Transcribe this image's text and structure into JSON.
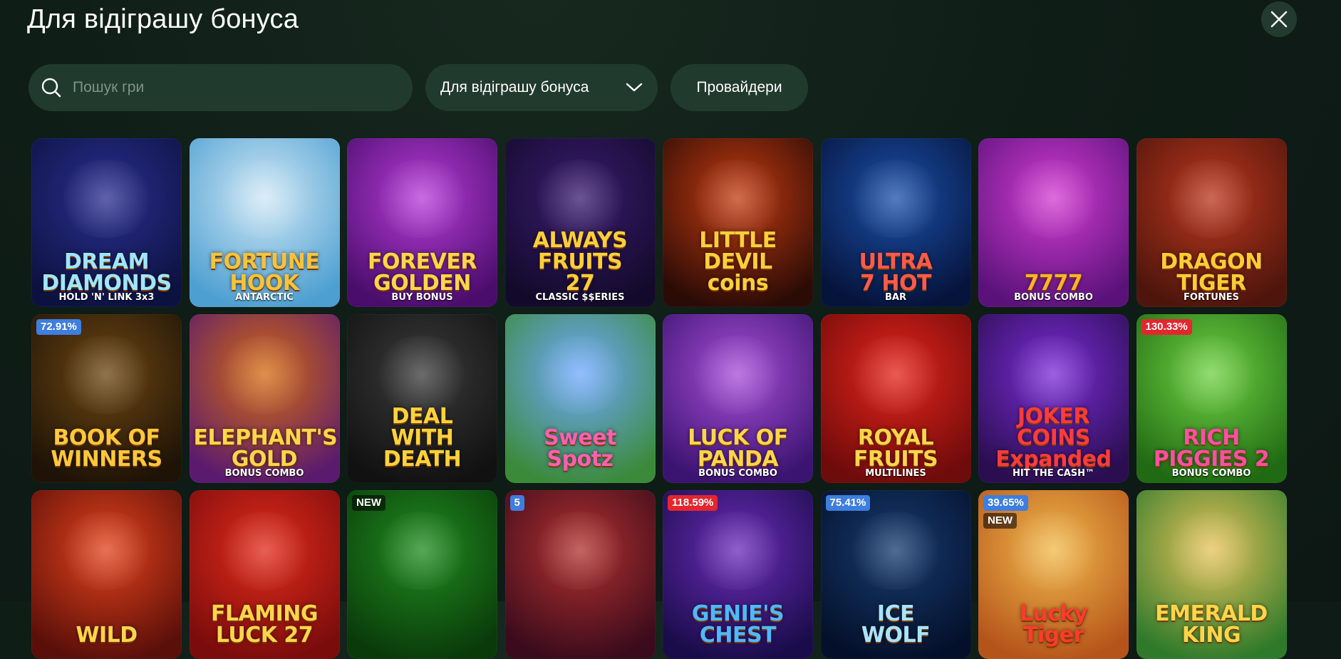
{
  "header": {
    "title": "Для відіграшу бонуса",
    "close_icon": "close-icon"
  },
  "search": {
    "placeholder": "Пошук гри",
    "value": "",
    "icon": "search-icon"
  },
  "filter": {
    "selected": "Для відіграшу бонуса",
    "icon": "chevron-down-icon"
  },
  "providers": {
    "label": "Провайдери"
  },
  "games": [
    {
      "name": "DREAM\nDIAMONDS",
      "sub": "HOLD 'N' LINK 3x3",
      "bg1": "#2a2e8f",
      "bg2": "#0c1240",
      "color": "#9fe6ff",
      "badges": []
    },
    {
      "name": "FORTUNE HOOK",
      "sub": "ANTARCTIC",
      "bg1": "#cfe7f5",
      "bg2": "#4d9fd1",
      "color": "#f7c33a",
      "badges": []
    },
    {
      "name": "FOREVER\nGOLDEN",
      "sub": "BUY BONUS",
      "bg1": "#b53bd6",
      "bg2": "#4a0d6b",
      "color": "#ffd54a",
      "badges": []
    },
    {
      "name": "ALWAYS\nFRUITS\n27",
      "sub": "CLASSIC $$ERIES",
      "bg1": "#3a1b6e",
      "bg2": "#120a2a",
      "color": "#ffcf3a",
      "badges": []
    },
    {
      "name": "LITTLE\nDEVIL\ncoins",
      "sub": "",
      "bg1": "#c23a10",
      "bg2": "#2a0b06",
      "color": "#ffcf3a",
      "badges": []
    },
    {
      "name": "ULTRA\n7 HOT",
      "sub": "BAR",
      "bg1": "#1a4fa8",
      "bg2": "#06133a",
      "color": "#ff5a4a",
      "badges": []
    },
    {
      "name": "7777",
      "sub": "BONUS COMBO",
      "bg1": "#d13bd0",
      "bg2": "#5a127a",
      "color": "#ffb22b",
      "badges": []
    },
    {
      "name": "DRAGON\nTIGER",
      "sub": "FORTUNES",
      "bg1": "#b8361d",
      "bg2": "#4e150c",
      "color": "#ffcc33",
      "badges": []
    },
    {
      "name": "BOOK OF\nWINNERS",
      "sub": "",
      "bg1": "#6b4512",
      "bg2": "#1e1306",
      "color": "#ffc83a",
      "badges": [
        {
          "text": "72.91%",
          "style": "blue"
        }
      ]
    },
    {
      "name": "ELEPHANT'S\nGOLD",
      "sub": "BONUS COMBO",
      "bg1": "#d36a12",
      "bg2": "#5a1a6e",
      "color": "#ffd54a",
      "badges": []
    },
    {
      "name": "DEAL\nWITH\nDEATH",
      "sub": "",
      "bg1": "#3a3a3a",
      "bg2": "#111111",
      "color": "#ffd23a",
      "badges": []
    },
    {
      "name": "Sweet\nSpotz",
      "sub": "",
      "bg1": "#6fa8ff",
      "bg2": "#3b8a3a",
      "color": "#ff5fb0",
      "badges": []
    },
    {
      "name": "LUCK OF\nPANDA",
      "sub": "BONUS COMBO",
      "bg1": "#a64dd6",
      "bg2": "#3b1370",
      "color": "#ffd54a",
      "badges": []
    },
    {
      "name": "ROYAL\nFRUITS",
      "sub": "MULTILINES",
      "bg1": "#e2231a",
      "bg2": "#6e0b0b",
      "color": "#ffd54a",
      "badges": []
    },
    {
      "name": "JOKER COINS\nExpanded",
      "sub": "HIT THE CASH™",
      "bg1": "#7a2bd6",
      "bg2": "#2a0e4f",
      "color": "#ff3b3b",
      "badges": []
    },
    {
      "name": "RICH\nPIGGIES 2",
      "sub": "BONUS COMBO",
      "bg1": "#6fd043",
      "bg2": "#1f6a12",
      "color": "#ff4fa0",
      "badges": [
        {
          "text": "130.33%",
          "style": "red"
        }
      ]
    },
    {
      "name": "WILD",
      "sub": "",
      "bg1": "#e0411a",
      "bg2": "#5a0f0a",
      "color": "#ffd54a",
      "badges": []
    },
    {
      "name": "FLAMING\nLUCK 27",
      "sub": "",
      "bg1": "#e02a1a",
      "bg2": "#7a0c0c",
      "color": "#ffd54a",
      "badges": []
    },
    {
      "name": "",
      "sub": "",
      "bg1": "#1f8a1f",
      "bg2": "#0a3a0a",
      "color": "#ffd54a",
      "badges": [
        {
          "text": "NEW",
          "style": "new"
        }
      ]
    },
    {
      "name": "",
      "sub": "",
      "bg1": "#b0302e",
      "bg2": "#3a0b1c",
      "color": "#ffd54a",
      "badges": [
        {
          "text": "5",
          "style": "blue"
        }
      ]
    },
    {
      "name": "GENIE'S\nCHEST",
      "sub": "",
      "bg1": "#6a2bb8",
      "bg2": "#1a0c4a",
      "color": "#4fb8ff",
      "badges": [
        {
          "text": "118.59%",
          "style": "red"
        }
      ]
    },
    {
      "name": "ICE\nWOLF",
      "sub": "",
      "bg1": "#163a6e",
      "bg2": "#04102a",
      "color": "#a8e4ff",
      "badges": [
        {
          "text": "75.41%",
          "style": "blue"
        }
      ]
    },
    {
      "name": "Lucky\nTiger",
      "sub": "",
      "bg1": "#f0b84a",
      "bg2": "#b5541a",
      "color": "#ff3b2b",
      "badges": [
        {
          "text": "39.65%",
          "style": "blue"
        },
        {
          "text": "NEW",
          "style": "new"
        }
      ]
    },
    {
      "name": "EMERALD KING",
      "sub": "",
      "bg1": "#e6c25a",
      "bg2": "#2e7a2a",
      "color": "#ffd54a",
      "badges": []
    }
  ]
}
